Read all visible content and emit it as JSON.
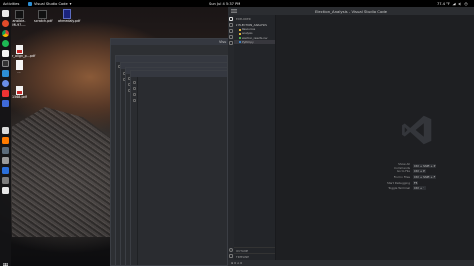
{
  "topbar": {
    "activities": "Activities",
    "app_name": "Visual Studio Code",
    "clock": "Sun Jul 4  5:37 PM",
    "status_text": "77.4 °F"
  },
  "desktop_icons": [
    {
      "label": "ansible-ML97-...",
      "kind": "dark"
    },
    {
      "label": "scratch.pdf",
      "kind": "dark"
    },
    {
      "label": "ahmedaly.pdf",
      "kind": "blue"
    },
    {
      "label": "r_align_p...pdf",
      "kind": "pdf"
    },
    {
      "label": "...",
      "kind": "white"
    },
    {
      "label": "1568.pdf",
      "kind": "pdf"
    }
  ],
  "vscode": {
    "title": "Election_Analysis - Visual Studio Code",
    "sidebar_header": "EXPLORER",
    "folder": "ELECTION_ANALYSIS",
    "files": [
      "Resources",
      "analysis",
      "election_results.csv",
      "PyPoll.py"
    ],
    "outline_label": "OUTLINE",
    "timeline_label": "TIMELINE",
    "shortcuts": [
      {
        "label": "Show All Commands",
        "key": "Ctrl + Shift + P"
      },
      {
        "label": "Go to File",
        "key": "Ctrl + P"
      },
      {
        "label": "Find in Files",
        "key": "Ctrl + Shift + F"
      },
      {
        "label": "Start Debugging",
        "key": "F5"
      },
      {
        "label": "Toggle Terminal",
        "key": "Ctrl + `"
      }
    ],
    "status_items": [
      "⊗ 0  ⚠ 0",
      "",
      ""
    ]
  },
  "ghost_window_label": "Visu",
  "colors": {
    "accent": "#2d8fd5",
    "topbar": "#000000",
    "vscode_bg": "#1e1f22"
  }
}
